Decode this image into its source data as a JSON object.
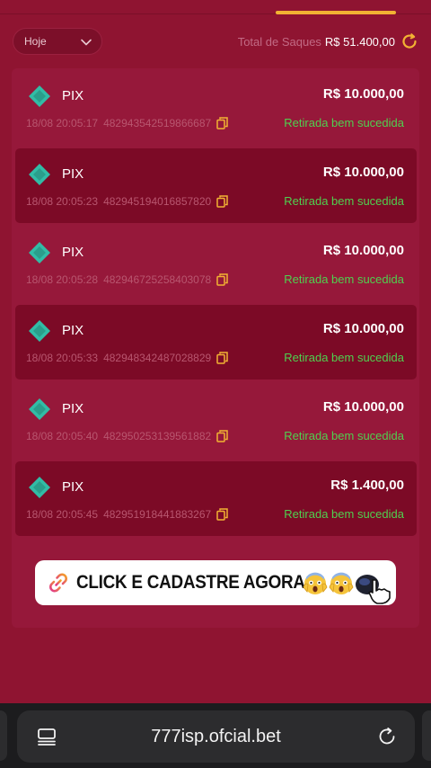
{
  "filter": {
    "date_range": "Hoje"
  },
  "summary": {
    "total_label": "Total de Saques",
    "total_value": "R$ 51.400,00"
  },
  "withdrawals": [
    {
      "method": "PIX",
      "amount": "R$ 10.000,00",
      "timestamp": "18/08 20:05:17",
      "id": "482943542519866687",
      "status": "Retirada bem sucedida"
    },
    {
      "method": "PIX",
      "amount": "R$ 10.000,00",
      "timestamp": "18/08 20:05:23",
      "id": "482945194016857820",
      "status": "Retirada bem sucedida"
    },
    {
      "method": "PIX",
      "amount": "R$ 10.000,00",
      "timestamp": "18/08 20:05:28",
      "id": "482946725258403078",
      "status": "Retirada bem sucedida"
    },
    {
      "method": "PIX",
      "amount": "R$ 10.000,00",
      "timestamp": "18/08 20:05:33",
      "id": "482948342487028829",
      "status": "Retirada bem sucedida"
    },
    {
      "method": "PIX",
      "amount": "R$ 10.000,00",
      "timestamp": "18/08 20:05:40",
      "id": "482950253139561882",
      "status": "Retirada bem sucedida"
    },
    {
      "method": "PIX",
      "amount": "R$ 1.400,00",
      "timestamp": "18/08 20:05:45",
      "id": "482951918441883267",
      "status": "Retirada bem sucedida"
    }
  ],
  "banner": {
    "text": "CLICK E CADASTRE AGORA",
    "icons": [
      "link-icon",
      "scream-emoji",
      "scream-emoji",
      "pointing-hand-mouse"
    ]
  },
  "browser": {
    "url": "777isp.ofcial.bet",
    "icons": [
      "tabs-icon",
      "reload-icon"
    ]
  },
  "colors": {
    "background": "#8f1431",
    "row_alt": "#7c0a26",
    "accent": "#f2b233",
    "success": "#4fd04f",
    "pix": "#32bca6"
  }
}
